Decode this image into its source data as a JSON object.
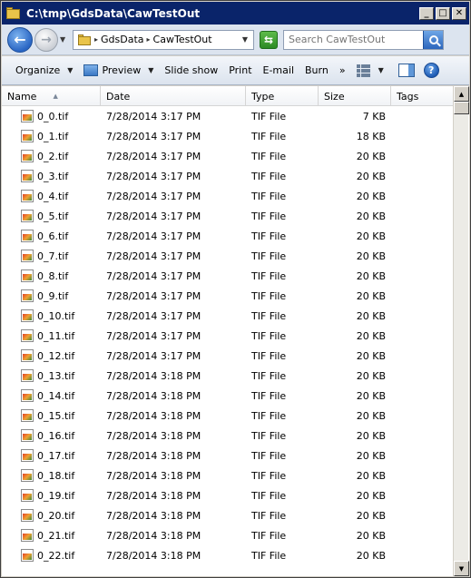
{
  "window": {
    "title": "C:\\tmp\\GdsData\\CawTestOut"
  },
  "titlebar_buttons": {
    "minimize": "_",
    "maximize": "□",
    "close": "✕"
  },
  "address": {
    "crumbs": [
      "GdsData",
      "CawTestOut"
    ],
    "search_placeholder": "Search CawTestOut"
  },
  "toolbar": {
    "organize": "Organize",
    "preview": "Preview",
    "slideshow": "Slide show",
    "print": "Print",
    "email": "E-mail",
    "burn": "Burn",
    "more": "»",
    "help": "?"
  },
  "columns": {
    "name": "Name",
    "date": "Date",
    "type": "Type",
    "size": "Size",
    "tags": "Tags"
  },
  "files": [
    {
      "name": "0_0.tif",
      "date": "7/28/2014 3:17 PM",
      "type": "TIF File",
      "size": "7 KB"
    },
    {
      "name": "0_1.tif",
      "date": "7/28/2014 3:17 PM",
      "type": "TIF File",
      "size": "18 KB"
    },
    {
      "name": "0_2.tif",
      "date": "7/28/2014 3:17 PM",
      "type": "TIF File",
      "size": "20 KB"
    },
    {
      "name": "0_3.tif",
      "date": "7/28/2014 3:17 PM",
      "type": "TIF File",
      "size": "20 KB"
    },
    {
      "name": "0_4.tif",
      "date": "7/28/2014 3:17 PM",
      "type": "TIF File",
      "size": "20 KB"
    },
    {
      "name": "0_5.tif",
      "date": "7/28/2014 3:17 PM",
      "type": "TIF File",
      "size": "20 KB"
    },
    {
      "name": "0_6.tif",
      "date": "7/28/2014 3:17 PM",
      "type": "TIF File",
      "size": "20 KB"
    },
    {
      "name": "0_7.tif",
      "date": "7/28/2014 3:17 PM",
      "type": "TIF File",
      "size": "20 KB"
    },
    {
      "name": "0_8.tif",
      "date": "7/28/2014 3:17 PM",
      "type": "TIF File",
      "size": "20 KB"
    },
    {
      "name": "0_9.tif",
      "date": "7/28/2014 3:17 PM",
      "type": "TIF File",
      "size": "20 KB"
    },
    {
      "name": "0_10.tif",
      "date": "7/28/2014 3:17 PM",
      "type": "TIF File",
      "size": "20 KB"
    },
    {
      "name": "0_11.tif",
      "date": "7/28/2014 3:17 PM",
      "type": "TIF File",
      "size": "20 KB"
    },
    {
      "name": "0_12.tif",
      "date": "7/28/2014 3:17 PM",
      "type": "TIF File",
      "size": "20 KB"
    },
    {
      "name": "0_13.tif",
      "date": "7/28/2014 3:18 PM",
      "type": "TIF File",
      "size": "20 KB"
    },
    {
      "name": "0_14.tif",
      "date": "7/28/2014 3:18 PM",
      "type": "TIF File",
      "size": "20 KB"
    },
    {
      "name": "0_15.tif",
      "date": "7/28/2014 3:18 PM",
      "type": "TIF File",
      "size": "20 KB"
    },
    {
      "name": "0_16.tif",
      "date": "7/28/2014 3:18 PM",
      "type": "TIF File",
      "size": "20 KB"
    },
    {
      "name": "0_17.tif",
      "date": "7/28/2014 3:18 PM",
      "type": "TIF File",
      "size": "20 KB"
    },
    {
      "name": "0_18.tif",
      "date": "7/28/2014 3:18 PM",
      "type": "TIF File",
      "size": "20 KB"
    },
    {
      "name": "0_19.tif",
      "date": "7/28/2014 3:18 PM",
      "type": "TIF File",
      "size": "20 KB"
    },
    {
      "name": "0_20.tif",
      "date": "7/28/2014 3:18 PM",
      "type": "TIF File",
      "size": "20 KB"
    },
    {
      "name": "0_21.tif",
      "date": "7/28/2014 3:18 PM",
      "type": "TIF File",
      "size": "20 KB"
    },
    {
      "name": "0_22.tif",
      "date": "7/28/2014 3:18 PM",
      "type": "TIF File",
      "size": "20 KB"
    }
  ]
}
